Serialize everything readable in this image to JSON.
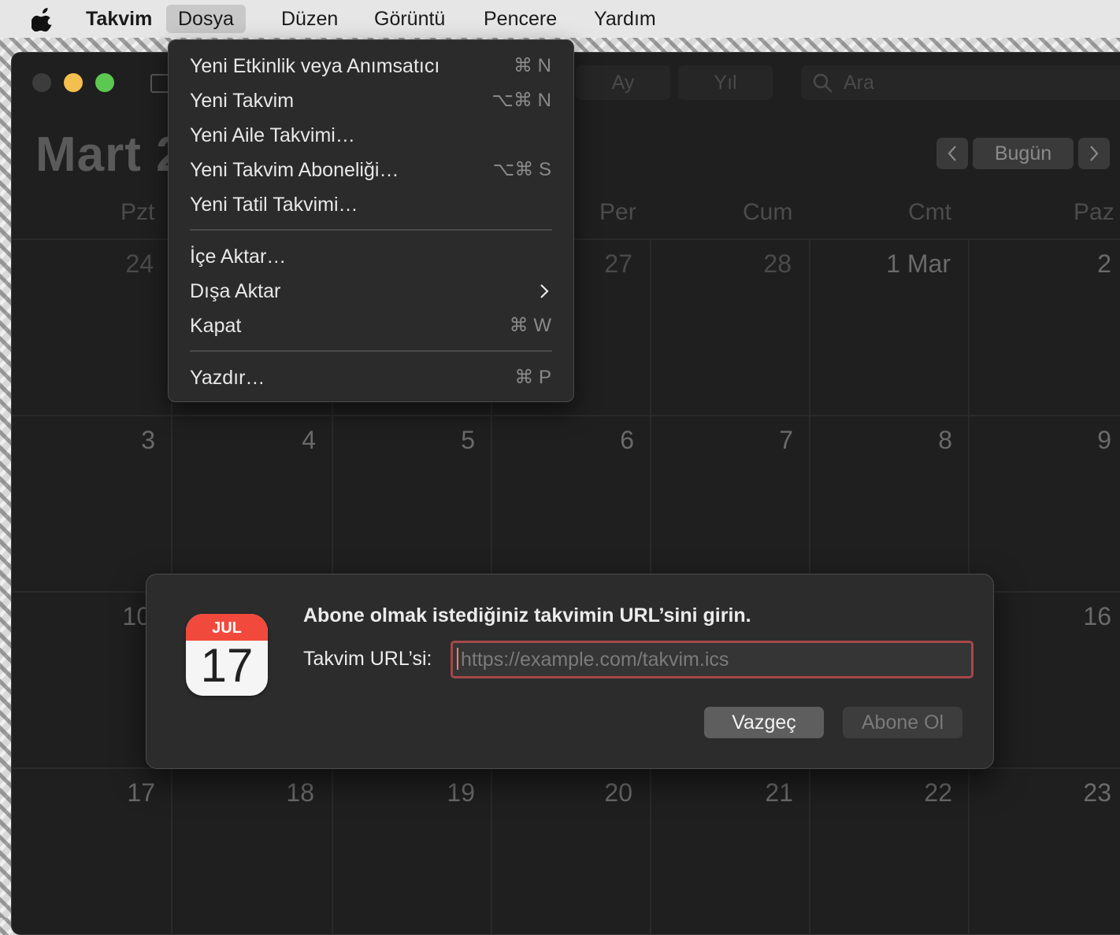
{
  "menubar": {
    "app": "Takvim",
    "items": [
      "Dosya",
      "Düzen",
      "Görüntü",
      "Pencere",
      "Yardım"
    ],
    "active": "Dosya"
  },
  "toolbar": {
    "view_month": "Ay",
    "view_year": "Yıl",
    "search_placeholder": "Ara",
    "today_label": "Bugün",
    "prev": "<",
    "next": ">"
  },
  "calendar": {
    "month_title": "Mart 2",
    "weekdays": [
      "Pzt",
      "Per",
      "Cum",
      "Cmt",
      "Paz"
    ],
    "rows": [
      {
        "cells": [
          "24",
          "27",
          "28",
          "1 Mar",
          "2"
        ]
      },
      {
        "cells": [
          "3",
          "4",
          "5",
          "6",
          "7",
          "8",
          "9"
        ]
      },
      {
        "cells": [
          "10",
          "16"
        ]
      },
      {
        "cells": [
          "17",
          "18",
          "19",
          "20",
          "21",
          "22",
          "23"
        ]
      }
    ]
  },
  "file_menu": {
    "items": [
      {
        "label": "Yeni Etkinlik veya Anımsatıcı",
        "shortcut": "⌘ N"
      },
      {
        "label": "Yeni Takvim",
        "shortcut": "⌥⌘ N"
      },
      {
        "label": "Yeni Aile Takvimi…",
        "shortcut": ""
      },
      {
        "label": "Yeni Takvim Aboneliği…",
        "shortcut": "⌥⌘ S"
      },
      {
        "label": "Yeni Tatil Takvimi…",
        "shortcut": ""
      },
      {
        "label": "İçe Aktar…",
        "shortcut": ""
      },
      {
        "label": "Dışa Aktar",
        "shortcut": ""
      },
      {
        "label": "Kapat",
        "shortcut": "⌘ W"
      },
      {
        "label": "Yazdır…",
        "shortcut": "⌘ P"
      }
    ]
  },
  "dialog": {
    "icon_month": "JUL",
    "icon_day": "17",
    "title": "Abone olmak istediğiniz takvimin URL’sini girin.",
    "url_label": "Takvim URL’si:",
    "url_placeholder": "https://example.com/takvim.ics",
    "url_value": "",
    "cancel": "Vazgeç",
    "subscribe": "Abone Ol"
  }
}
